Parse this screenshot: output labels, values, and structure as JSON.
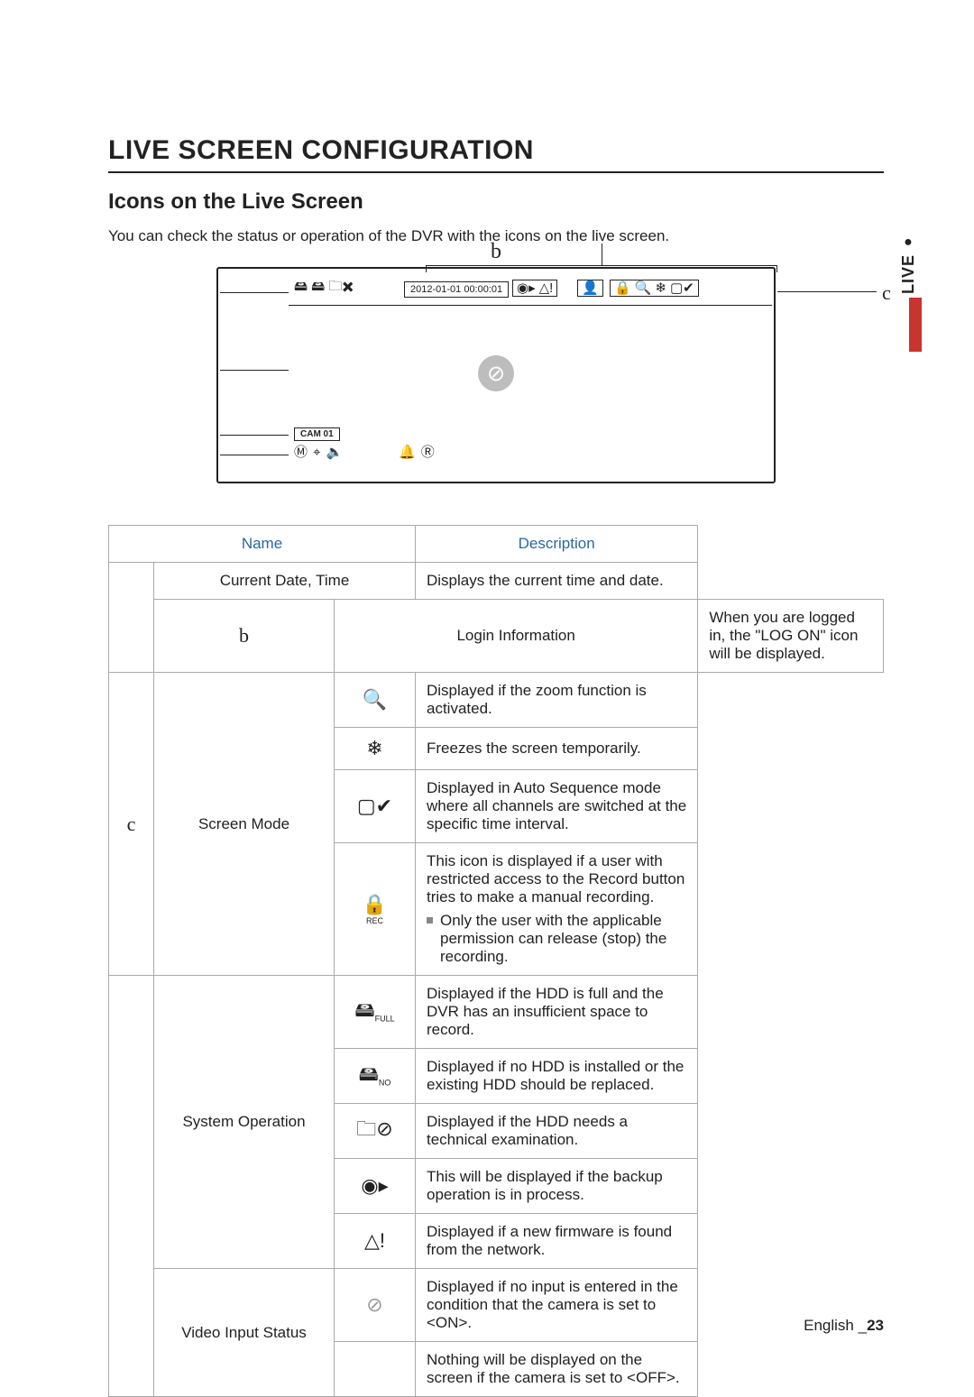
{
  "sideTab": "LIVE",
  "h1": "LIVE SCREEN CONFIGURATION",
  "h2": "Icons on the Live Screen",
  "intro": "You can check the status or operation of the DVR with the icons on the live screen.",
  "diagram": {
    "topLetter": "b",
    "rightLetter": "c",
    "dateBox": "2012-01-01  00:00:01",
    "camLabel": "CAM 01"
  },
  "table": {
    "head": {
      "name": "Name",
      "desc": "Description"
    },
    "rows": [
      {
        "letter": "",
        "label": "Current Date, Time",
        "icon": "",
        "desc": "Displays the current time and date.",
        "letterSpan": 0,
        "labelSpan": 1,
        "labelColspan": 2
      },
      {
        "letter": "b",
        "label": "Login Information",
        "icon": "",
        "desc": "When you are logged in, the \"LOG ON\" icon will be displayed.",
        "letterSpan": 1,
        "labelSpan": 1,
        "labelColspan": 2
      },
      {
        "letter": "c",
        "label": "Screen Mode",
        "icon": "zoom",
        "desc": "Displayed if the zoom function is activated.",
        "letterSpan": 4,
        "labelSpan": 4
      },
      {
        "icon": "freeze",
        "desc": "Freezes the screen temporarily."
      },
      {
        "icon": "autoseq",
        "desc": "Displayed in Auto Sequence mode where all channels are switched at the specific time interval."
      },
      {
        "icon": "reclock",
        "desc": "This icon is displayed if a user with restricted access to the Record button tries to make a manual recording.",
        "note": "Only the user with the applicable permission can release (stop) the recording."
      },
      {
        "letter": "",
        "label": "System Operation",
        "icon": "hddfull",
        "desc": "Displayed if the HDD is full and the DVR has an insufficient space to record.",
        "labelSpan": 5
      },
      {
        "icon": "nohdd",
        "desc": "Displayed if no HDD is installed or the existing HDD should be replaced."
      },
      {
        "icon": "hddfail",
        "desc": "Displayed if the HDD needs a technical examination."
      },
      {
        "icon": "backup",
        "desc": "This will be displayed if the backup operation is in process."
      },
      {
        "icon": "fw",
        "desc": "Displayed if a new firmware is found from the network."
      },
      {
        "letter": "",
        "label": "Video Input Status",
        "icon": "novideo",
        "desc": "Displayed if no input is entered in the condition that the camera is set to <ON>.",
        "labelSpan": 2
      },
      {
        "icon": "",
        "desc": "Nothing will be displayed on the screen if the camera is set to <OFF>."
      }
    ]
  },
  "footer": {
    "lang": "English",
    "page": "23"
  }
}
